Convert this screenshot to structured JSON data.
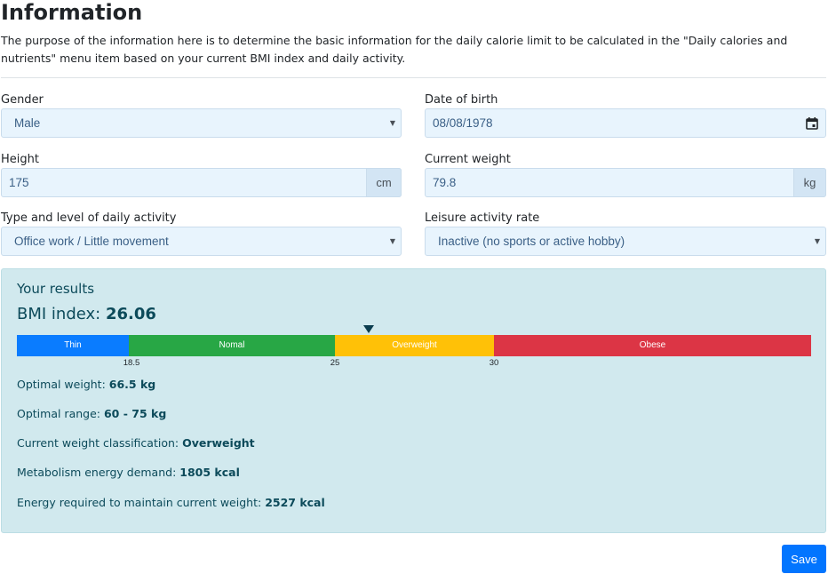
{
  "header": {
    "title": "Information",
    "intro": "The purpose of the information here is to determine the basic information for the daily calorie limit to be calculated in the \"Daily calories and nutrients\" menu item based on your current BMI index and daily activity."
  },
  "form": {
    "gender": {
      "label": "Gender",
      "value": "Male"
    },
    "dob": {
      "label": "Date of birth",
      "value": "08/08/1978"
    },
    "height": {
      "label": "Height",
      "value": "175",
      "unit": "cm"
    },
    "weight": {
      "label": "Current weight",
      "value": "79.8",
      "unit": "kg"
    },
    "activity": {
      "label": "Type and level of daily activity",
      "value": "Office work / Little movement"
    },
    "leisure": {
      "label": "Leisure activity rate",
      "value": "Inactive (no sports or active hobby)"
    }
  },
  "results": {
    "title": "Your results",
    "bmi_label": "BMI index:",
    "bmi_value": "26.06",
    "bmi_numeric": 26.06,
    "scale": {
      "segments": [
        {
          "label": "Thin",
          "from": 15,
          "to": 18.5,
          "color": "#0a7cff"
        },
        {
          "label": "Nomal",
          "from": 18.5,
          "to": 25,
          "color": "#28a745"
        },
        {
          "label": "Overweight",
          "from": 25,
          "to": 30,
          "color": "#ffc107"
        },
        {
          "label": "Obese",
          "from": 30,
          "to": 40,
          "color": "#dc3545"
        }
      ],
      "ticks": [
        "18.5",
        "25",
        "30"
      ]
    },
    "optimal_weight": {
      "label": "Optimal weight:",
      "value": "66.5 kg"
    },
    "optimal_range": {
      "label": "Optimal range:",
      "value": "60 - 75 kg"
    },
    "classification": {
      "label": "Current weight classification:",
      "value": "Overweight"
    },
    "metabolism": {
      "label": "Metabolism energy demand:",
      "value": "1805 kcal"
    },
    "maintain": {
      "label": "Energy required to maintain current weight:",
      "value": "2527 kcal"
    }
  },
  "actions": {
    "save_label": "Save"
  }
}
